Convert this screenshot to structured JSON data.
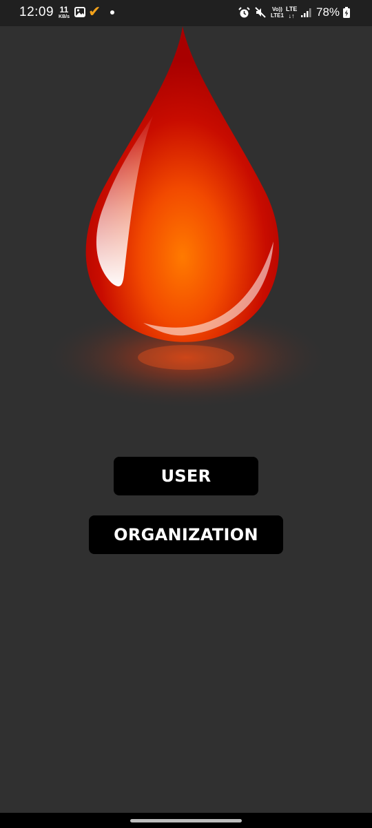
{
  "status_bar": {
    "time": "12:09",
    "net_speed_value": "11",
    "net_speed_unit": "KB/s",
    "volte_top": "Vo))",
    "volte_bottom": "LTE1",
    "lte_top": "LTE",
    "lte_bottom": "↓↑",
    "battery_percent": "78%",
    "icons": [
      "gallery-icon",
      "check-icon",
      "notification-dot",
      "alarm-icon",
      "mute-icon",
      "signal-icon",
      "battery-charging-icon"
    ],
    "check_color": "#f3a21b"
  },
  "hero": {
    "icon": "blood-drop-icon",
    "colors": {
      "drop_dark": "#b50000",
      "drop_light": "#ff7a00"
    }
  },
  "buttons": {
    "user_label": "USER",
    "organization_label": "ORGANIZATION"
  },
  "theme": {
    "background": "#303030",
    "button_background": "#000000",
    "button_text": "#ffffff"
  }
}
